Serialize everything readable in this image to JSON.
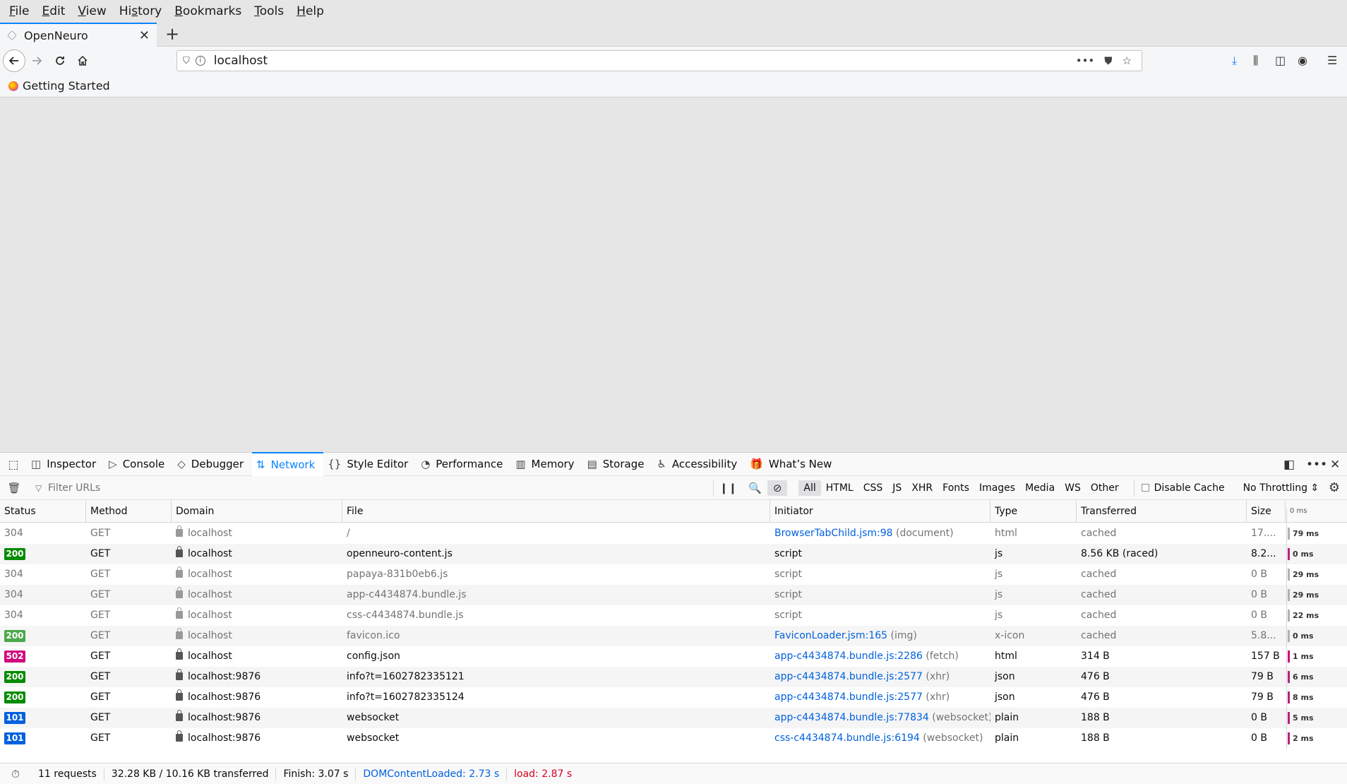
{
  "menu": [
    {
      "pre": "",
      "u": "F",
      "post": "ile"
    },
    {
      "pre": "",
      "u": "E",
      "post": "dit"
    },
    {
      "pre": "",
      "u": "V",
      "post": "iew"
    },
    {
      "pre": "Hi",
      "u": "s",
      "post": "tory"
    },
    {
      "pre": "",
      "u": "B",
      "post": "ookmarks"
    },
    {
      "pre": "",
      "u": "T",
      "post": "ools"
    },
    {
      "pre": "",
      "u": "H",
      "post": "elp"
    }
  ],
  "tab": {
    "title": "OpenNeuro",
    "close": "✕",
    "new": "+"
  },
  "nav": {
    "url": "localhost",
    "page_actions": "•••"
  },
  "bookmarks": [
    {
      "label": "Getting Started"
    }
  ],
  "devtools": {
    "tabs": [
      {
        "icon": "◫",
        "label": "Inspector"
      },
      {
        "icon": "▷",
        "label": "Console"
      },
      {
        "icon": "◇",
        "label": "Debugger"
      },
      {
        "icon": "⇅",
        "label": "Network"
      },
      {
        "icon": "{}",
        "label": "Style Editor"
      },
      {
        "icon": "◔",
        "label": "Performance"
      },
      {
        "icon": "▥",
        "label": "Memory"
      },
      {
        "icon": "▤",
        "label": "Storage"
      },
      {
        "icon": "♿",
        "label": "Accessibility"
      },
      {
        "icon": "🎁",
        "label": "What’s New"
      }
    ],
    "active_tab": "Network"
  },
  "filter": {
    "placeholder": "Filter URLs",
    "types": [
      "All",
      "HTML",
      "CSS",
      "JS",
      "XHR",
      "Fonts",
      "Images",
      "Media",
      "WS",
      "Other"
    ],
    "active_type": "All",
    "disable_cache": "Disable Cache",
    "throttling": "No Throttling ⇕"
  },
  "columns": {
    "status": "Status",
    "method": "Method",
    "domain": "Domain",
    "file": "File",
    "initiator": "Initiator",
    "type": "Type",
    "transferred": "Transferred",
    "size": "Size",
    "waterfall": "0 ms"
  },
  "requests": [
    {
      "status": "304",
      "method": "GET",
      "domain": "localhost",
      "file": "/",
      "init_link": "BrowserTabChild.jsm:98",
      "init_tag": " (document)",
      "type": "html",
      "transferred": "cached",
      "size": "17....",
      "time": "79 ms",
      "cached": true,
      "color": "#888888"
    },
    {
      "status": "200",
      "method": "GET",
      "domain": "localhost",
      "file": "openneuro-content.js",
      "init_link": "",
      "init_tag": "script",
      "type": "js",
      "transferred": "8.56 KB (raced)",
      "size": "8.2...",
      "time": "0 ms",
      "cached": false,
      "color": "#058b00"
    },
    {
      "status": "304",
      "method": "GET",
      "domain": "localhost",
      "file": "papaya-831b0eb6.js",
      "init_link": "",
      "init_tag": "script",
      "type": "js",
      "transferred": "cached",
      "size": "0 B",
      "time": "29 ms",
      "cached": true,
      "color": "#888888"
    },
    {
      "status": "304",
      "method": "GET",
      "domain": "localhost",
      "file": "app-c4434874.bundle.js",
      "init_link": "",
      "init_tag": "script",
      "type": "js",
      "transferred": "cached",
      "size": "0 B",
      "time": "29 ms",
      "cached": true,
      "color": "#888888"
    },
    {
      "status": "304",
      "method": "GET",
      "domain": "localhost",
      "file": "css-c4434874.bundle.js",
      "init_link": "",
      "init_tag": "script",
      "type": "js",
      "transferred": "cached",
      "size": "0 B",
      "time": "22 ms",
      "cached": true,
      "color": "#888888"
    },
    {
      "status": "200",
      "method": "GET",
      "domain": "localhost",
      "file": "favicon.ico",
      "init_link": "FaviconLoader.jsm:165",
      "init_tag": " (img)",
      "type": "x-icon",
      "transferred": "cached",
      "size": "5.8...",
      "time": "0 ms",
      "cached": true,
      "color": "#4aa84a"
    },
    {
      "status": "502",
      "method": "GET",
      "domain": "localhost",
      "file": "config.json",
      "init_link": "app-c4434874.bundle.js:2286",
      "init_tag": " (fetch)",
      "type": "html",
      "transferred": "314 B",
      "size": "157 B",
      "time": "1 ms",
      "cached": false,
      "color": "#d0077f"
    },
    {
      "status": "200",
      "method": "GET",
      "domain": "localhost:9876",
      "file": "info?t=1602782335121",
      "init_link": "app-c4434874.bundle.js:2577",
      "init_tag": " (xhr)",
      "type": "json",
      "transferred": "476 B",
      "size": "79 B",
      "time": "6 ms",
      "cached": false,
      "color": "#058b00"
    },
    {
      "status": "200",
      "method": "GET",
      "domain": "localhost:9876",
      "file": "info?t=1602782335124",
      "init_link": "app-c4434874.bundle.js:2577",
      "init_tag": " (xhr)",
      "type": "json",
      "transferred": "476 B",
      "size": "79 B",
      "time": "8 ms",
      "cached": false,
      "color": "#058b00"
    },
    {
      "status": "101",
      "method": "GET",
      "domain": "localhost:9876",
      "file": "websocket",
      "init_link": "app-c4434874.bundle.js:77834",
      "init_tag": " (websocket)",
      "type": "plain",
      "transferred": "188 B",
      "size": "0 B",
      "time": "5 ms",
      "cached": false,
      "color": "#0060df"
    },
    {
      "status": "101",
      "method": "GET",
      "domain": "localhost:9876",
      "file": "websocket",
      "init_link": "css-c4434874.bundle.js:6194",
      "init_tag": " (websocket)",
      "type": "plain",
      "transferred": "188 B",
      "size": "0 B",
      "time": "2 ms",
      "cached": false,
      "color": "#0060df"
    }
  ],
  "summary": {
    "requests": "11 requests",
    "transferred": "32.28 KB / 10.16 KB transferred",
    "finish": "Finish: 3.07 s",
    "domcontentloaded": "DOMContentLoaded: 2.73 s",
    "load": "load: 2.87 s"
  }
}
